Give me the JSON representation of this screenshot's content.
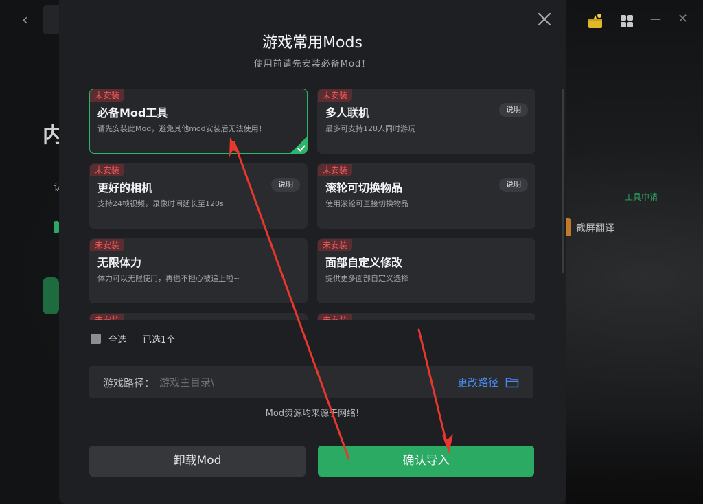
{
  "background": {
    "back_glyph": "‹",
    "heading_fragment": "内",
    "small_fragment": "认",
    "tool_apply": "工具申请",
    "screen_translate": "截屏翻译",
    "minimize_glyph": "—",
    "close_glyph": "✕"
  },
  "modal": {
    "title": "游戏常用Mods",
    "subtitle": "使用前请先安装必备Mod！",
    "mods": [
      {
        "badge": "未安装",
        "name": "必备Mod工具",
        "desc": "请先安装此Mod，避免其他mod安装后无法使用！",
        "selected": true,
        "info": ""
      },
      {
        "badge": "未安装",
        "name": "多人联机",
        "desc": "最多可支持128人同时游玩",
        "selected": false,
        "info": "说明"
      },
      {
        "badge": "未安装",
        "name": "更好的相机",
        "desc": "支持24帧视频，录像时间延长至120s",
        "selected": false,
        "info": "说明"
      },
      {
        "badge": "未安装",
        "name": "滚轮可切换物品",
        "desc": "使用滚轮可直接切换物品",
        "selected": false,
        "info": "说明"
      },
      {
        "badge": "未安装",
        "name": "无限体力",
        "desc": "体力可以无限使用，再也不担心被追上啦~",
        "selected": false,
        "info": ""
      },
      {
        "badge": "未安装",
        "name": "面部自定义修改",
        "desc": "提供更多面部自定义选择",
        "selected": false,
        "info": ""
      },
      {
        "badge": "未安装",
        "name": "",
        "desc": "",
        "selected": false,
        "info": ""
      },
      {
        "badge": "未安装",
        "name": "",
        "desc": "",
        "selected": false,
        "info": ""
      }
    ],
    "select_all": "全选",
    "selected_count": "已选1个",
    "path_label": "游戏路径：",
    "path_placeholder": "游戏主目录\\",
    "path_value": "",
    "change_path": "更改路径",
    "source_note": "Mod资源均来源于网络!",
    "uninstall_button": "卸载Mod",
    "confirm_button": "确认导入"
  },
  "colors": {
    "accent_green": "#2baa64",
    "badge_red": "#ef5b5b",
    "link_blue": "#4a8bf0",
    "annotation_red": "#e8382e"
  }
}
